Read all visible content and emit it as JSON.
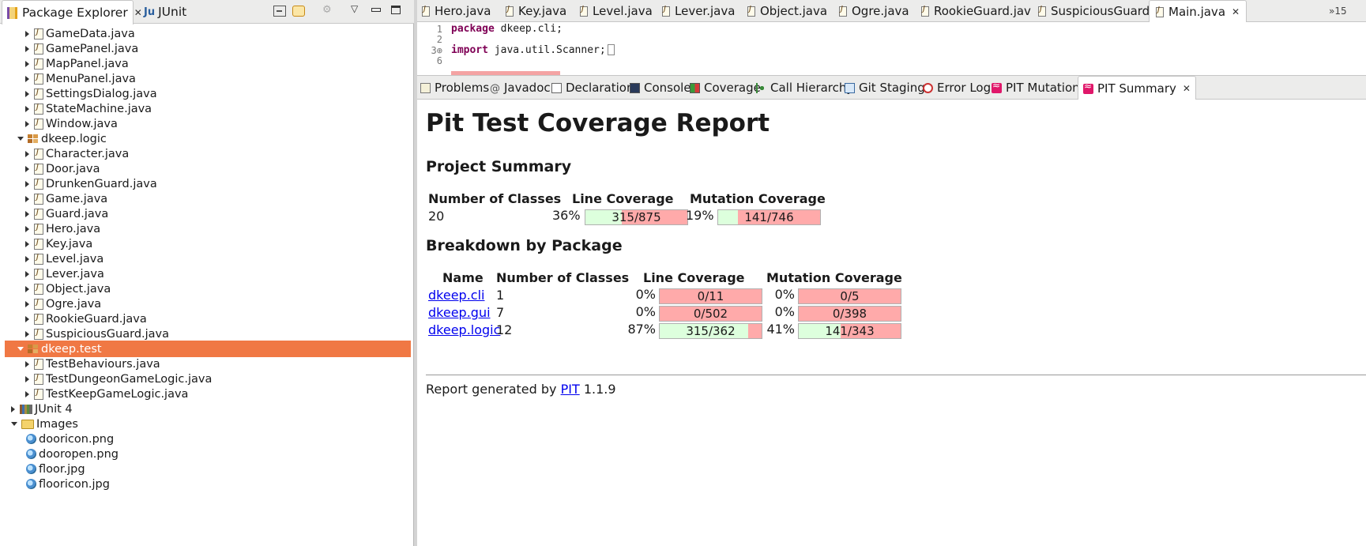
{
  "explorer": {
    "tab_label": "Package Explorer",
    "junit_tab_label": "JUnit",
    "items": [
      {
        "label": "GameData.java",
        "kind": "file",
        "level": 2
      },
      {
        "label": "GamePanel.java",
        "kind": "file",
        "level": 2
      },
      {
        "label": "MapPanel.java",
        "kind": "file",
        "level": 2
      },
      {
        "label": "MenuPanel.java",
        "kind": "file",
        "level": 2
      },
      {
        "label": "SettingsDialog.java",
        "kind": "file",
        "level": 2
      },
      {
        "label": "StateMachine.java",
        "kind": "file",
        "level": 2
      },
      {
        "label": "Window.java",
        "kind": "file",
        "level": 2
      },
      {
        "label": "dkeep.logic",
        "kind": "package",
        "level": 1,
        "expanded": true
      },
      {
        "label": "Character.java",
        "kind": "file",
        "level": 2
      },
      {
        "label": "Door.java",
        "kind": "file",
        "level": 2
      },
      {
        "label": "DrunkenGuard.java",
        "kind": "file",
        "level": 2
      },
      {
        "label": "Game.java",
        "kind": "file",
        "level": 2
      },
      {
        "label": "Guard.java",
        "kind": "file",
        "level": 2
      },
      {
        "label": "Hero.java",
        "kind": "file",
        "level": 2
      },
      {
        "label": "Key.java",
        "kind": "file",
        "level": 2
      },
      {
        "label": "Level.java",
        "kind": "file",
        "level": 2
      },
      {
        "label": "Lever.java",
        "kind": "file",
        "level": 2
      },
      {
        "label": "Object.java",
        "kind": "file",
        "level": 2
      },
      {
        "label": "Ogre.java",
        "kind": "file",
        "level": 2
      },
      {
        "label": "RookieGuard.java",
        "kind": "file",
        "level": 2
      },
      {
        "label": "SuspiciousGuard.java",
        "kind": "file",
        "level": 2
      },
      {
        "label": "dkeep.test",
        "kind": "package",
        "level": 1,
        "expanded": true,
        "selected": true
      },
      {
        "label": "TestBehaviours.java",
        "kind": "file",
        "level": 2
      },
      {
        "label": "TestDungeonGameLogic.java",
        "kind": "file",
        "level": 2
      },
      {
        "label": "TestKeepGameLogic.java",
        "kind": "file",
        "level": 2
      },
      {
        "label": "JUnit 4",
        "kind": "library",
        "level": 0
      },
      {
        "label": "Images",
        "kind": "folder",
        "level": 0,
        "expanded": true
      },
      {
        "label": "dooricon.png",
        "kind": "image",
        "level": 1
      },
      {
        "label": "dooropen.png",
        "kind": "image",
        "level": 1
      },
      {
        "label": "floor.jpg",
        "kind": "image",
        "level": 1
      },
      {
        "label": "flooricon.jpg",
        "kind": "image",
        "level": 1
      }
    ]
  },
  "editor": {
    "tabs": [
      "Hero.java",
      "Key.java",
      "Level.java",
      "Lever.java",
      "Object.java",
      "Ogre.java",
      "RookieGuard.jav",
      "SuspiciousGuard",
      "Main.java"
    ],
    "active_tab": "Main.java",
    "more_tabs": "»15",
    "lines": [
      {
        "num": "1",
        "keyword": "package",
        "rest": " dkeep.cli;"
      },
      {
        "num": "2",
        "keyword": "",
        "rest": ""
      },
      {
        "num": "3⊕",
        "keyword": "import",
        "rest": " java.util.Scanner;"
      },
      {
        "num": "6",
        "keyword": "",
        "rest": ""
      }
    ]
  },
  "views": {
    "tabs": [
      "Problems",
      "Javadoc",
      "Declaration",
      "Console",
      "Coverage",
      "Call Hierarchy",
      "Git Staging",
      "Error Log",
      "PIT Mutations",
      "PIT Summary"
    ],
    "active_tab": "PIT Summary"
  },
  "report": {
    "title": "Pit Test Coverage Report",
    "project_summary_heading": "Project Summary",
    "summary_headers": [
      "Number of Classes",
      "Line Coverage",
      "Mutation Coverage"
    ],
    "summary": {
      "classes": "20",
      "line_pct": "36%",
      "line_ratio": "315/875",
      "line_fill": 0.36,
      "mutation_pct": "19%",
      "mutation_ratio": "141/746",
      "mutation_fill": 0.19
    },
    "breakdown_heading": "Breakdown by Package",
    "breakdown_headers": [
      "Name",
      "Number of Classes",
      "Line Coverage",
      "Mutation Coverage"
    ],
    "packages": [
      {
        "name": "dkeep.cli",
        "classes": "1",
        "line_pct": "0%",
        "line_ratio": "0/11",
        "line_fill": 0.0,
        "mutation_pct": "0%",
        "mutation_ratio": "0/5",
        "mutation_fill": 0.0
      },
      {
        "name": "dkeep.gui",
        "classes": "7",
        "line_pct": "0%",
        "line_ratio": "0/502",
        "line_fill": 0.0,
        "mutation_pct": "0%",
        "mutation_ratio": "0/398",
        "mutation_fill": 0.0
      },
      {
        "name": "dkeep.logic",
        "classes": "12",
        "line_pct": "87%",
        "line_ratio": "315/362",
        "line_fill": 0.87,
        "mutation_pct": "41%",
        "mutation_ratio": "141/343",
        "mutation_fill": 0.41
      }
    ],
    "footer_prefix": "Report generated by",
    "footer_link": "PIT",
    "footer_version": "1.1.9"
  },
  "colors": {
    "selection": "#f07844",
    "coverage_covered": "#ddffdd",
    "coverage_uncovered": "#ffaaaa",
    "keyword": "#7f0055"
  }
}
